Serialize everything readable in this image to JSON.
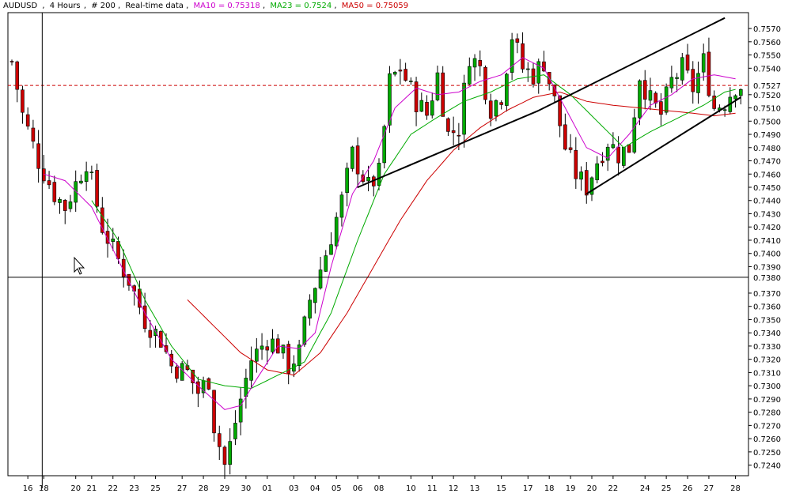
{
  "header": {
    "symbol": "AUDUSD",
    "timeframe": "4 Hours",
    "bars": "# 200",
    "feed": "Real-time data",
    "ma10_label": "MA10 = 0.75318",
    "ma23_label": "MA23 = 0.7524",
    "ma50_label": "MA50 = 0.75059",
    "separator": ",",
    "colors": {
      "text": "#000000",
      "ma10": "#cc00cc",
      "ma23": "#00aa00",
      "ma50": "#cc0000"
    }
  },
  "chart_data": {
    "type": "candlestick",
    "title": "AUDUSD , 4 Hours , # 200, Real-time data",
    "ylim": [
      0.7232,
      0.7582
    ],
    "y_ticks": [
      "0.7570",
      "0.7560",
      "0.7550",
      "0.7540",
      "0.7520",
      "0.7510",
      "0.7500",
      "0.7490",
      "0.7480",
      "0.7470",
      "0.7460",
      "0.7450",
      "0.7440",
      "0.7430",
      "0.7420",
      "0.7410",
      "0.7400",
      "0.7390",
      "0.7370",
      "0.7360",
      "0.7350",
      "0.7340",
      "0.7330",
      "0.7320",
      "0.7310",
      "0.7300",
      "0.7290",
      "0.7280",
      "0.7270",
      "0.7260",
      "0.7250",
      "0.7240"
    ],
    "x_ticks": [
      "16",
      "18",
      "20",
      "21",
      "22",
      "23",
      "25",
      "27",
      "28",
      "29",
      "30",
      "01",
      "03",
      "04",
      "05",
      "06",
      "08",
      "10",
      "11",
      "12",
      "13",
      "15",
      "17",
      "18",
      "19",
      "20",
      "22",
      "24",
      "25",
      "26",
      "27",
      "28"
    ],
    "x_tick_bar_index": [
      3,
      6,
      12,
      15,
      19,
      23,
      27,
      32,
      36,
      40,
      44,
      48,
      53,
      57,
      61,
      65,
      69,
      75,
      79,
      83,
      87,
      92,
      97,
      101,
      105,
      109,
      113,
      119,
      123,
      127,
      131,
      136
    ],
    "num_bars": 138,
    "anchors": [
      [
        0,
        0.7545
      ],
      [
        2,
        0.7505
      ],
      [
        5,
        0.747
      ],
      [
        8,
        0.7445
      ],
      [
        10,
        0.7435
      ],
      [
        14,
        0.747
      ],
      [
        17,
        0.742
      ],
      [
        20,
        0.7395
      ],
      [
        22,
        0.738
      ],
      [
        25,
        0.735
      ],
      [
        28,
        0.7335
      ],
      [
        30,
        0.7315
      ],
      [
        33,
        0.731
      ],
      [
        35,
        0.7295
      ],
      [
        37,
        0.7305
      ],
      [
        38,
        0.727
      ],
      [
        40,
        0.724
      ],
      [
        41,
        0.7255
      ],
      [
        43,
        0.729
      ],
      [
        45,
        0.732
      ],
      [
        48,
        0.7335
      ],
      [
        50,
        0.733
      ],
      [
        52,
        0.7315
      ],
      [
        54,
        0.7325
      ],
      [
        56,
        0.7365
      ],
      [
        59,
        0.74
      ],
      [
        62,
        0.744
      ],
      [
        64,
        0.7475
      ],
      [
        67,
        0.745
      ],
      [
        69,
        0.746
      ],
      [
        71,
        0.753
      ],
      [
        73,
        0.754
      ],
      [
        76,
        0.7515
      ],
      [
        78,
        0.7505
      ],
      [
        80,
        0.7535
      ],
      [
        82,
        0.749
      ],
      [
        84,
        0.7495
      ],
      [
        86,
        0.755
      ],
      [
        88,
        0.754
      ],
      [
        90,
        0.751
      ],
      [
        92,
        0.752
      ],
      [
        94,
        0.7565
      ],
      [
        96,
        0.754
      ],
      [
        98,
        0.7535
      ],
      [
        100,
        0.7545
      ],
      [
        102,
        0.7515
      ],
      [
        104,
        0.748
      ],
      [
        106,
        0.746
      ],
      [
        108,
        0.745
      ],
      [
        110,
        0.747
      ],
      [
        112,
        0.7485
      ],
      [
        114,
        0.7475
      ],
      [
        116,
        0.748
      ],
      [
        118,
        0.7535
      ],
      [
        120,
        0.7515
      ],
      [
        122,
        0.7505
      ],
      [
        124,
        0.753
      ],
      [
        126,
        0.754
      ],
      [
        128,
        0.7525
      ],
      [
        130,
        0.7545
      ],
      [
        132,
        0.751
      ],
      [
        134,
        0.7515
      ],
      [
        136,
        0.7527
      ]
    ],
    "ma10_anchors": [
      [
        6,
        0.746
      ],
      [
        10,
        0.7455
      ],
      [
        15,
        0.7435
      ],
      [
        20,
        0.7395
      ],
      [
        25,
        0.7355
      ],
      [
        30,
        0.732
      ],
      [
        35,
        0.73
      ],
      [
        40,
        0.7282
      ],
      [
        43,
        0.7285
      ],
      [
        46,
        0.7305
      ],
      [
        50,
        0.733
      ],
      [
        54,
        0.7328
      ],
      [
        57,
        0.734
      ],
      [
        60,
        0.739
      ],
      [
        64,
        0.7445
      ],
      [
        68,
        0.747
      ],
      [
        72,
        0.751
      ],
      [
        76,
        0.7525
      ],
      [
        80,
        0.752
      ],
      [
        84,
        0.7522
      ],
      [
        88,
        0.753
      ],
      [
        92,
        0.7535
      ],
      [
        96,
        0.7548
      ],
      [
        100,
        0.754
      ],
      [
        104,
        0.751
      ],
      [
        108,
        0.748
      ],
      [
        112,
        0.7472
      ],
      [
        116,
        0.749
      ],
      [
        120,
        0.7512
      ],
      [
        124,
        0.752
      ],
      [
        128,
        0.7532
      ],
      [
        132,
        0.7535
      ],
      [
        136,
        0.7532
      ]
    ],
    "ma23_anchors": [
      [
        15,
        0.744
      ],
      [
        20,
        0.741
      ],
      [
        25,
        0.7365
      ],
      [
        30,
        0.733
      ],
      [
        35,
        0.7305
      ],
      [
        40,
        0.73
      ],
      [
        45,
        0.7298
      ],
      [
        50,
        0.7308
      ],
      [
        55,
        0.7318
      ],
      [
        60,
        0.7355
      ],
      [
        65,
        0.741
      ],
      [
        70,
        0.746
      ],
      [
        75,
        0.749
      ],
      [
        80,
        0.7503
      ],
      [
        85,
        0.7515
      ],
      [
        90,
        0.7522
      ],
      [
        95,
        0.7532
      ],
      [
        100,
        0.7535
      ],
      [
        105,
        0.752
      ],
      [
        110,
        0.75
      ],
      [
        115,
        0.748
      ],
      [
        120,
        0.7492
      ],
      [
        125,
        0.7502
      ],
      [
        130,
        0.7512
      ],
      [
        134,
        0.7522
      ],
      [
        136,
        0.7524
      ]
    ],
    "ma50_anchors": [
      [
        33,
        0.7365
      ],
      [
        38,
        0.7345
      ],
      [
        43,
        0.7325
      ],
      [
        48,
        0.7312
      ],
      [
        53,
        0.7308
      ],
      [
        58,
        0.7325
      ],
      [
        63,
        0.7355
      ],
      [
        68,
        0.739
      ],
      [
        73,
        0.7425
      ],
      [
        78,
        0.7455
      ],
      [
        83,
        0.7478
      ],
      [
        88,
        0.7495
      ],
      [
        93,
        0.7508
      ],
      [
        98,
        0.7518
      ],
      [
        103,
        0.7522
      ],
      [
        108,
        0.7515
      ],
      [
        113,
        0.7512
      ],
      [
        118,
        0.751
      ],
      [
        123,
        0.7508
      ],
      [
        128,
        0.7506
      ],
      [
        132,
        0.7504
      ],
      [
        136,
        0.7506
      ]
    ],
    "trendlines": [
      {
        "name": "lower-left-channel",
        "from": [
          65,
          0.745
        ],
        "to": [
          99,
          0.7508
        ]
      },
      {
        "name": "upper-left-channel",
        "from": [
          99,
          0.7508
        ],
        "to": [
          134,
          0.7578
        ]
      },
      {
        "name": "lower-right-channel",
        "from": [
          108,
          0.7445
        ],
        "to": [
          137,
          0.7518
        ]
      }
    ],
    "levels": {
      "dashed": {
        "value": 0.7527,
        "label": "0.7527",
        "color": "#cc0000"
      },
      "crosshair": {
        "value": 0.7382,
        "label": "0.7380",
        "color": "#0000cc",
        "x_bar": 6
      }
    },
    "colors": {
      "bull": "#00aa00",
      "bear": "#cc0000",
      "wick": "#000000",
      "ma10": "#cc00cc",
      "ma23": "#00aa00",
      "ma50": "#cc0000",
      "trend": "#000000"
    }
  }
}
